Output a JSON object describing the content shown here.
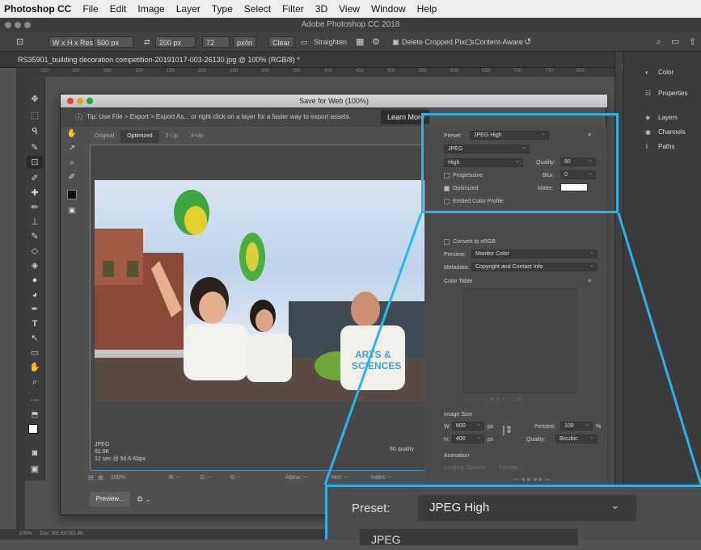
{
  "menubar": {
    "app": "Photoshop CC",
    "items": [
      "File",
      "Edit",
      "Image",
      "Layer",
      "Type",
      "Select",
      "Filter",
      "3D",
      "View",
      "Window",
      "Help"
    ]
  },
  "window_title": "Adobe Photoshop CC 2018",
  "options": {
    "ratio": "W x H x Reso...",
    "width": "500 px",
    "height": "200 px",
    "resolution": "72",
    "unit": "px/in",
    "clear": "Clear",
    "straighten": "Straighten",
    "delete_cropped": "Delete Cropped Pixels",
    "content_aware": "Content-Aware"
  },
  "doc_tab": "RS35901_building decoration competition-20191017-003-26130.jpg @ 100% (RGB/8) *",
  "ruler_ticks": [
    "250",
    "300",
    "350",
    "100",
    "150",
    "200",
    "250",
    "300",
    "350",
    "400",
    "450",
    "500",
    "550",
    "600",
    "650",
    "700",
    "750",
    "800"
  ],
  "panels": [
    {
      "icon": "color-icon",
      "glyph": "◐",
      "label": "Color"
    },
    {
      "icon": "properties-icon",
      "glyph": "☷",
      "label": "Properties"
    },
    {
      "icon": "layers-icon",
      "glyph": "◈",
      "label": "Layers"
    },
    {
      "icon": "channels-icon",
      "glyph": "◉",
      "label": "Channels"
    },
    {
      "icon": "paths-icon",
      "glyph": "⌇",
      "label": "Paths"
    }
  ],
  "dialog": {
    "title": "Save for Web (100%)",
    "tip": "Tip: Use File > Export > Export As...  or right click on a layer for a faster way to export assets.",
    "learn_more": "Learn More",
    "tabs": [
      "Original",
      "Optimized",
      "2-Up",
      "4-Up"
    ],
    "active_tab": "Optimized",
    "preview_info": [
      "JPEG",
      "61.9K",
      "12 sec @ 56.6 Kbps"
    ],
    "preview_quality": "60 quality",
    "zoom": "100%",
    "readout": {
      "r": "R: --",
      "g": "G: --",
      "b": "B: --",
      "alpha": "Alpha: --",
      "hex": "Hex: --",
      "index": "Index: --"
    },
    "preview_button": "Preview..."
  },
  "settings": {
    "preset_label": "Preset:",
    "preset": "JPEG High",
    "format": "JPEG",
    "compression": "High",
    "quality_label": "Quality:",
    "quality": "60",
    "progressive": "Progressive",
    "blur_label": "Blur:",
    "blur": "0",
    "optimized": "Optimized",
    "matte_label": "Matte:",
    "embed": "Embed Color Profile",
    "convert": "Convert to sRGB",
    "preview_label": "Preview:",
    "preview": "Monitor Color",
    "metadata_label": "Metadata:",
    "metadata": "Copyright and Contact Info",
    "color_table": "Color Table",
    "image_size": "Image Size",
    "w_label": "W:",
    "w": "600",
    "h_label": "H:",
    "h": "400",
    "px": "px",
    "percent_label": "Percent:",
    "percent": "100",
    "pct": "%",
    "resample_label": "Quality:",
    "resample": "Bicubic",
    "animation": "Animation",
    "looping_label": "Looping Options:",
    "looping": "Forever"
  },
  "zoom_inset": {
    "preset_label": "Preset:",
    "preset": "JPEG High",
    "format": "JPEG"
  },
  "status": {
    "zoom": "100%",
    "doc": "Doc: 351.6K/351.6K"
  },
  "colors": {
    "highlight": "#27b7e6"
  }
}
